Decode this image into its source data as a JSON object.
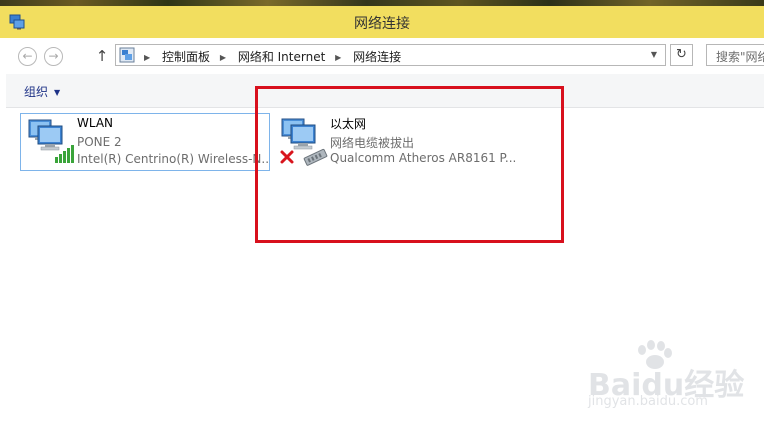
{
  "window": {
    "title": "网络连接"
  },
  "address": {
    "back_icon": "back-arrow-icon",
    "forward_icon": "forward-arrow-icon",
    "up_icon": "up-arrow-icon",
    "breadcrumbs": [
      "控制面板",
      "网络和 Internet",
      "网络连接"
    ],
    "search_placeholder": "搜索\"网络"
  },
  "toolbar": {
    "organize_label": "组织"
  },
  "connections": [
    {
      "name": "WLAN",
      "status": "PONE  2",
      "device": "Intel(R) Centrino(R) Wireless-N...",
      "selected": true,
      "icon": "wireless-network-icon"
    },
    {
      "name": "以太网",
      "status": "网络电缆被拔出",
      "device": "Qualcomm Atheros AR8161 P...",
      "selected": false,
      "icon": "ethernet-disconnected-icon"
    }
  ],
  "colors": {
    "titlebar": "#f2de5f",
    "highlight_box": "#d8101d",
    "selection_border": "#7eb4ea",
    "link": "#1e3287"
  },
  "watermark": {
    "text": "Baidu经验",
    "url": "jingyan.baidu.com"
  }
}
